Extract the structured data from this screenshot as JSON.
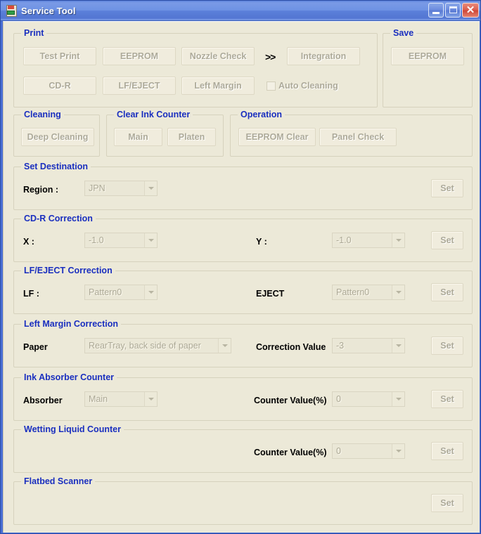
{
  "window": {
    "title": "Service Tool",
    "icon": "printer-icon",
    "controls": {
      "minimize": "minimize-icon",
      "maximize": "maximize-icon",
      "close": "close-icon"
    }
  },
  "colors": {
    "legend": "#1a2fbf",
    "client_bg": "#ece9d8",
    "title_bar": "#6e92e4",
    "close_button": "#cf4737",
    "disabled_text": "#adaa99"
  },
  "groups": {
    "print": {
      "legend": "Print",
      "buttons": [
        {
          "label": "Test Print"
        },
        {
          "label": "EEPROM"
        },
        {
          "label": "Nozzle Check"
        },
        {
          "label": "Integration"
        },
        {
          "label": "CD-R"
        },
        {
          "label": "LF/EJECT"
        },
        {
          "label": "Left Margin"
        }
      ],
      "chevron": ">>",
      "checkbox": {
        "label": "Auto Cleaning",
        "checked": false
      }
    },
    "save": {
      "legend": "Save",
      "buttons": [
        {
          "label": "EEPROM"
        }
      ]
    },
    "cleaning": {
      "legend": "Cleaning",
      "buttons": [
        {
          "label": "Deep Cleaning"
        }
      ]
    },
    "clear_ink_counter": {
      "legend": "Clear Ink Counter",
      "buttons": [
        {
          "label": "Main"
        },
        {
          "label": "Platen"
        }
      ]
    },
    "operation": {
      "legend": "Operation",
      "buttons": [
        {
          "label": "EEPROM Clear"
        },
        {
          "label": "Panel Check"
        }
      ]
    },
    "set_destination": {
      "legend": "Set Destination",
      "field_label": "Region :",
      "field_value": "JPN",
      "set_label": "Set"
    },
    "cdr_correction": {
      "legend": "CD-R Correction",
      "x_label": "X :",
      "x_value": "-1.0",
      "y_label": "Y :",
      "y_value": "-1.0",
      "set_label": "Set"
    },
    "lf_eject_correction": {
      "legend": "LF/EJECT Correction",
      "lf_label": "LF :",
      "lf_value": "Pattern0",
      "eject_label": "EJECT",
      "eject_value": "Pattern0",
      "set_label": "Set"
    },
    "left_margin_correction": {
      "legend": "Left Margin Correction",
      "paper_label": "Paper",
      "paper_value": "RearTray, back side of paper",
      "correction_label": "Correction Value",
      "correction_value": "-3",
      "set_label": "Set"
    },
    "ink_absorber_counter": {
      "legend": "Ink Absorber Counter",
      "absorber_label": "Absorber",
      "absorber_value": "Main",
      "counter_label": "Counter Value(%)",
      "counter_value": "0",
      "set_label": "Set"
    },
    "wetting_liquid_counter": {
      "legend": "Wetting Liquid Counter",
      "counter_label": "Counter Value(%)",
      "counter_value": "0",
      "set_label": "Set"
    },
    "flatbed_scanner": {
      "legend": "Flatbed Scanner",
      "set_label": "Set"
    }
  }
}
